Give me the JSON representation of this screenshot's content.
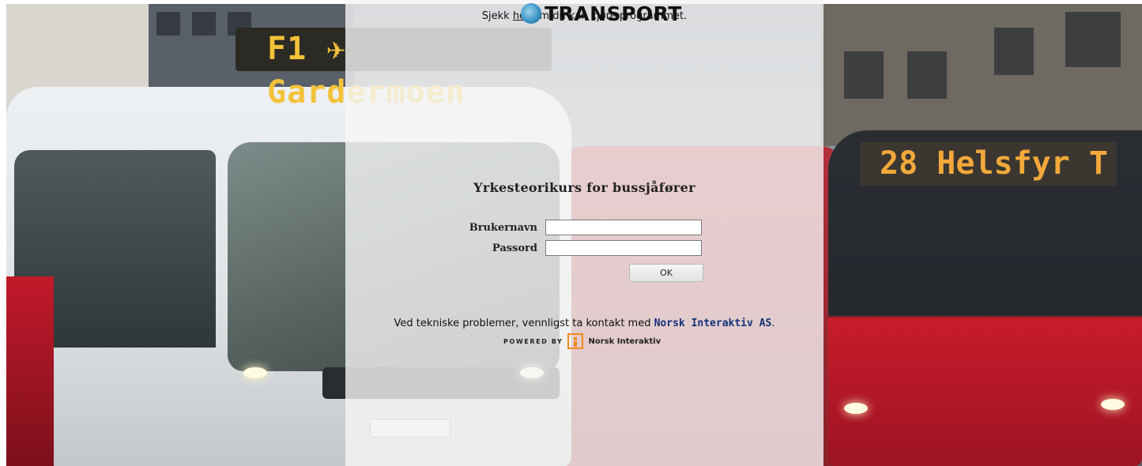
{
  "header": {
    "notice_prefix": "Sjekk",
    "notice_link": "her",
    "notice_suffix": "om du kan kjøre programmet.",
    "logo_text": "TRANSPORT"
  },
  "background": {
    "bus_left_sign": "F1 ✈ Gardermoen",
    "bus_right_sign": "28 Helsfyr T"
  },
  "login": {
    "title": "Yrkesteorikurs for bussjåfører",
    "username_label": "Brukernavn",
    "username_value": "",
    "password_label": "Passord",
    "password_value": "",
    "ok_label": "OK"
  },
  "footer": {
    "support_text": "Ved tekniske problemer, vennligst ta kontakt med",
    "support_link": "Norsk Interaktiv AS",
    "support_end": ".",
    "powered_by": "POWERED BY",
    "powered_name": "Norsk Interaktiv"
  },
  "colors": {
    "link_blue": "#13307a",
    "logo_orange": "#f08a1c",
    "overlay": "#f5f5f5"
  }
}
